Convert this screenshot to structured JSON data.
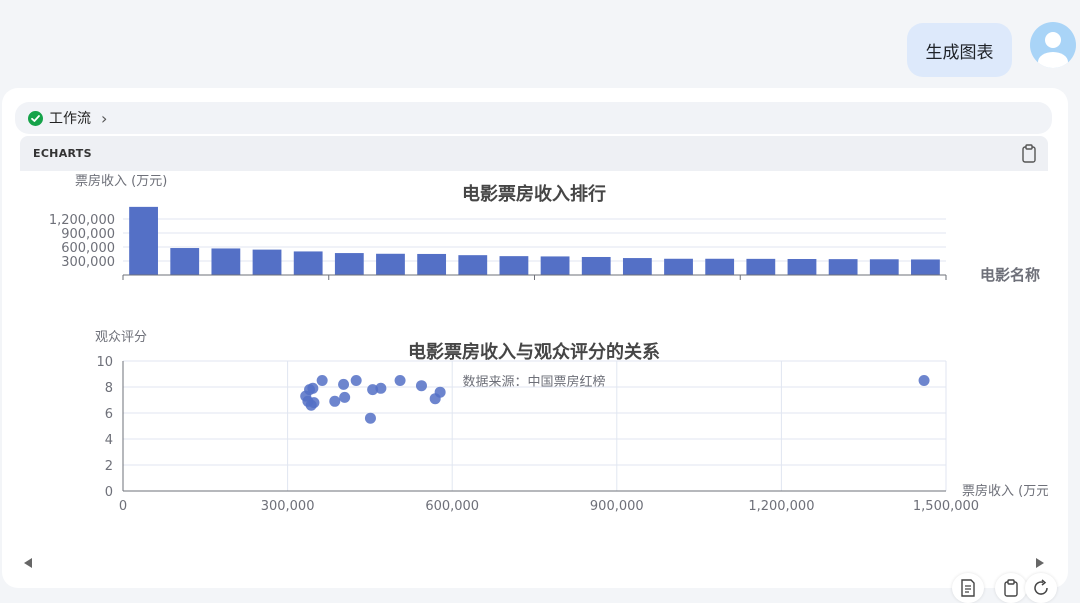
{
  "chat": {
    "user_message": "生成图表"
  },
  "workflow": {
    "label": "工作流"
  },
  "code_block": {
    "language_label": "ECHARTS"
  },
  "colors": {
    "series": "#5470c6",
    "axis": "#6e7079",
    "grid": "#e0e6f1",
    "title": "#464646",
    "check": "#16a34a"
  },
  "chart_data": [
    {
      "type": "bar",
      "title": "电影票房收入排行",
      "xlabel": "电影名称",
      "ylabel": "票房收入 (万元)",
      "ylim": [
        0,
        1500000
      ],
      "yticks": [
        0,
        300000,
        600000,
        900000,
        1200000
      ],
      "ytick_labels": [
        "300,000",
        "600,000",
        "900,000",
        "1,200,000"
      ],
      "grid": true,
      "values": [
        1460000,
        578000,
        569000,
        544000,
        505000,
        470000,
        455000,
        451000,
        425000,
        404000,
        398000,
        386000,
        363000,
        348000,
        348000,
        346000,
        343000,
        340000,
        337000,
        333000
      ]
    },
    {
      "type": "scatter",
      "title": "电影票房收入与观众评分的关系",
      "subtitle": "数据来源：中国票房红榜",
      "xlabel": "票房收入 (万元)",
      "ylabel": "观众评分",
      "xlim": [
        0,
        1500000
      ],
      "ylim": [
        0,
        10
      ],
      "xticks": [
        0,
        300000,
        600000,
        900000,
        1200000,
        1500000
      ],
      "xtick_labels": [
        "0",
        "300,000",
        "600,000",
        "900,000",
        "1,200,000",
        "1,500,000"
      ],
      "yticks": [
        0,
        2,
        4,
        6,
        8,
        10
      ],
      "ytick_labels": [
        "0",
        "2",
        "4",
        "6",
        "8",
        "10"
      ],
      "grid": true,
      "points": [
        [
          1460000,
          8.5
        ],
        [
          578000,
          7.6
        ],
        [
          569000,
          7.1
        ],
        [
          544000,
          8.1
        ],
        [
          505000,
          8.5
        ],
        [
          470000,
          7.9
        ],
        [
          455000,
          7.8
        ],
        [
          451000,
          5.6
        ],
        [
          425000,
          8.5
        ],
        [
          404000,
          7.2
        ],
        [
          402000,
          8.2
        ],
        [
          386000,
          6.9
        ],
        [
          363000,
          8.5
        ],
        [
          348000,
          6.8
        ],
        [
          346000,
          7.9
        ],
        [
          343000,
          6.6
        ],
        [
          340000,
          7.8
        ],
        [
          337000,
          6.9
        ],
        [
          333000,
          7.3
        ]
      ]
    }
  ]
}
